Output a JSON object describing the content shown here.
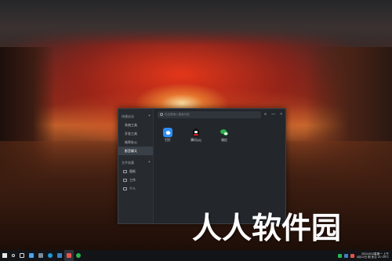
{
  "launcher": {
    "sidebar": {
      "group_quick": "快捷启动",
      "quick_items": [
        {
          "label": "系统工具",
          "active": false
        },
        {
          "label": "开发工具",
          "active": false
        },
        {
          "label": "效率办公",
          "active": false
        },
        {
          "label": "影音聊天",
          "active": true
        }
      ],
      "group_folders": "文件收藏",
      "folder_items": [
        {
          "label": "图纸",
          "icon": "folder-icon"
        },
        {
          "label": "工作",
          "icon": "folder-icon"
        },
        {
          "label": "个人",
          "icon": "folder-icon"
        }
      ],
      "add_symbol": "+"
    },
    "search": {
      "placeholder": "在这里输入搜索内容"
    },
    "window_controls": {
      "menu": "≡",
      "minimize": "—",
      "close": "×"
    },
    "apps": [
      {
        "label": "钉钉",
        "icon": "dingtalk-icon"
      },
      {
        "label": "腾讯QQ",
        "icon": "qq-icon"
      },
      {
        "label": "微信",
        "icon": "wechat-icon"
      }
    ]
  },
  "watermark": "人人软件园",
  "taskbar": {
    "clock_line1": "2021/4/12星期一 上午",
    "clock_line2": "4月12日 阴 多云 21~29°C"
  },
  "colors": {
    "launcher_bg": "#23272c",
    "sidebar_active": "#3a4047",
    "dingtalk": "#2f8ef4",
    "wechat": "#2bb24c",
    "taskbar_bg": "#121417"
  }
}
